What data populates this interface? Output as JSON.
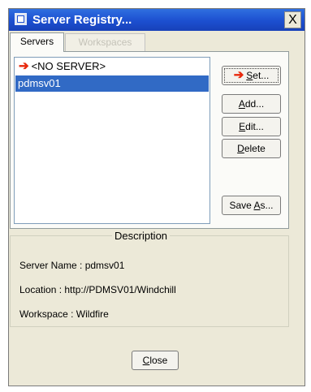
{
  "window": {
    "title": "Server Registry...",
    "close_glyph": "X"
  },
  "tabs": [
    {
      "label": "Servers",
      "active": true
    },
    {
      "label": "Workspaces",
      "active": false
    }
  ],
  "server_list": {
    "items": [
      {
        "label": "<NO SERVER>",
        "current": true,
        "selected": false
      },
      {
        "label": "pdmsv01",
        "current": false,
        "selected": true
      }
    ]
  },
  "buttons": {
    "set": {
      "label_pre": "",
      "accel": "S",
      "label_post": "et..."
    },
    "add": {
      "label_pre": "",
      "accel": "A",
      "label_post": "dd..."
    },
    "edit": {
      "label_pre": "",
      "accel": "E",
      "label_post": "dit..."
    },
    "delete": {
      "label_pre": "",
      "accel": "D",
      "label_post": "elete"
    },
    "save_as": {
      "label_pre": "Save ",
      "accel": "A",
      "label_post": "s..."
    },
    "close": {
      "label_pre": "",
      "accel": "C",
      "label_post": "lose"
    }
  },
  "description": {
    "legend": "Description",
    "server_name": "Server Name : pdmsv01",
    "location": "Location : http://PDMSV01/Windchill",
    "workspace": "Workspace : Wildfire"
  },
  "icons": {
    "current_marker": "right-arrow-icon",
    "current_marker_color": "#e8280c"
  },
  "colors": {
    "title_bar": "#1c4fd0",
    "selection": "#316ac5",
    "dialog_bg": "#ece9d8"
  }
}
